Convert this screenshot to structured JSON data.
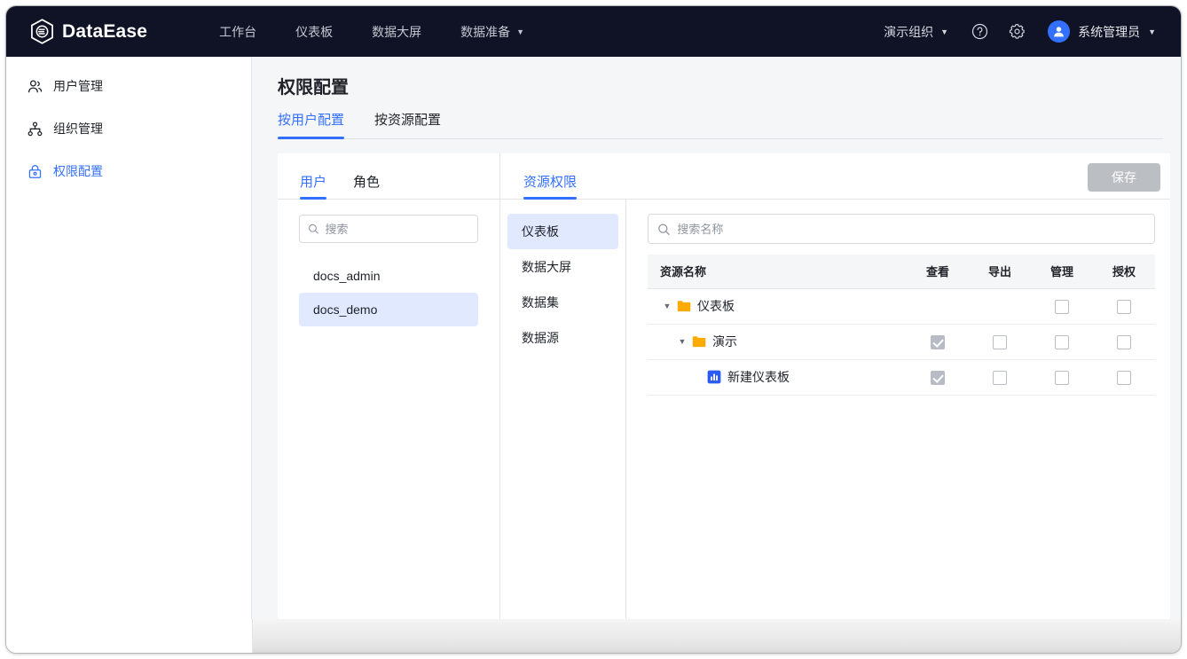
{
  "app": {
    "brand": "DataEase",
    "brand_icon": "dataease-logo-icon"
  },
  "topbar": {
    "nav_items": [
      {
        "label": "工作台",
        "has_caret": false
      },
      {
        "label": "仪表板",
        "has_caret": false
      },
      {
        "label": "数据大屏",
        "has_caret": false
      },
      {
        "label": "数据准备",
        "has_caret": true
      }
    ],
    "org_switch": "演示组织",
    "help_icon": "help-circle-icon",
    "settings_icon": "gear-icon",
    "avatar_icon": "user-avatar-icon",
    "user_name": "系统管理员",
    "caret": "▼"
  },
  "sidebar": {
    "items": [
      {
        "label": "用户管理",
        "icon": "users-icon",
        "active": false
      },
      {
        "label": "组织管理",
        "icon": "org-tree-icon",
        "active": false
      },
      {
        "label": "权限配置",
        "icon": "lock-icon",
        "active": true
      }
    ]
  },
  "main": {
    "title": "权限配置",
    "tabs": [
      {
        "label": "按用户配置",
        "active": true
      },
      {
        "label": "按资源配置",
        "active": false
      }
    ]
  },
  "users_panel": {
    "tabs": [
      {
        "label": "用户",
        "active": true
      },
      {
        "label": "角色",
        "active": false
      }
    ],
    "search": {
      "value": "",
      "placeholder": "搜索",
      "icon": "search-icon"
    },
    "items": [
      {
        "label": "docs_admin",
        "selected": false
      },
      {
        "label": "docs_demo",
        "selected": true
      }
    ]
  },
  "resource_panel": {
    "tab_label": "资源权限",
    "save_label": "保存",
    "save_disabled": true,
    "nav_items": [
      {
        "label": "仪表板",
        "selected": true
      },
      {
        "label": "数据大屏",
        "selected": false
      },
      {
        "label": "数据集",
        "selected": false
      },
      {
        "label": "数据源",
        "selected": false
      }
    ],
    "search": {
      "value": "",
      "placeholder": "搜索名称",
      "icon": "search-icon"
    },
    "table": {
      "columns": [
        "资源名称",
        "查看",
        "导出",
        "管理",
        "授权"
      ],
      "rows": [
        {
          "name": "仪表板",
          "indent": 0,
          "expanded": true,
          "has_caret": true,
          "icon": "folder-icon",
          "view": "none",
          "export": "none",
          "manage": "unchecked",
          "authorize": "unchecked"
        },
        {
          "name": "演示",
          "indent": 1,
          "expanded": true,
          "has_caret": true,
          "icon": "folder-icon",
          "view": "checked-disabled",
          "export": "unchecked",
          "manage": "unchecked",
          "authorize": "unchecked"
        },
        {
          "name": "新建仪表板",
          "indent": 2,
          "expanded": false,
          "has_caret": false,
          "icon": "dashboard-icon",
          "view": "checked-disabled",
          "export": "unchecked",
          "manage": "unchecked",
          "authorize": "unchecked"
        }
      ]
    }
  },
  "colors": {
    "brand_dark": "#0f1325",
    "accent": "#3370ff",
    "selected_bg": "#e0e9ff",
    "folder_yellow": "#ffaa00",
    "disabled_gray": "#bbbfc4"
  }
}
